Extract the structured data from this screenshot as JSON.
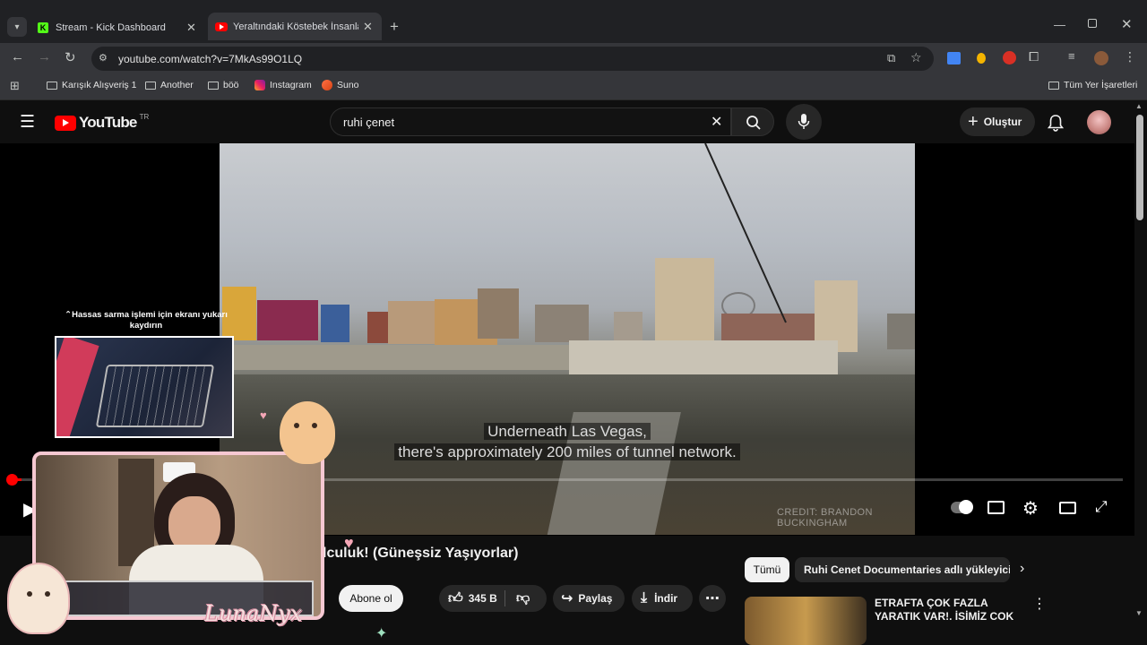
{
  "browser": {
    "tabs": [
      {
        "title": "Stream - Kick Dashboard",
        "active": false
      },
      {
        "title": "Yeraltındaki Köstebek İnsanlar'a",
        "active": true
      }
    ],
    "url": "youtube.com/watch?v=7MkAs99O1LQ",
    "bookmarks": [
      {
        "label": "Karışık Alışveriş 1",
        "icon": "folder-icon"
      },
      {
        "label": "Another",
        "icon": "folder-icon"
      },
      {
        "label": "böö",
        "icon": "folder-icon"
      },
      {
        "label": "Instagram",
        "icon": "instagram-icon"
      },
      {
        "label": "Suno",
        "icon": "suno-icon"
      }
    ],
    "all_bookmarks_label": "Tüm Yer İşaretleri"
  },
  "youtube": {
    "logo_text": "YouTube",
    "region": "TR",
    "search_value": "ruhi çenet",
    "create_label": "Oluştur"
  },
  "video": {
    "caption_line1": "Underneath Las Vegas,",
    "caption_line2": "there's approximately 200 miles of tunnel network.",
    "credit": "CREDIT: BRANDON BUCKINGHAM",
    "progress": 0.01
  },
  "below": {
    "title_fragment": "lculuk! (Güneşsiz Yaşıyorlar)",
    "subscribe_label": "Abone ol",
    "likes": "345 B",
    "share_label": "Paylaş",
    "download_label": "İndir"
  },
  "sidebar": {
    "chips": [
      {
        "label": "Tümü",
        "active": true
      },
      {
        "label": "Ruhi Cenet Documentaries adlı yükleyiciden",
        "active": false
      }
    ],
    "rec_title": "ETRAFTA ÇOK FAZLA YARATIK VAR!, İŞİMİZ ÇOK ZOR!..."
  },
  "overlay": {
    "scroll_hint": "Hassas sarma işlemi için ekranı yukarı kaydırın",
    "streamer_name": "LunaNyx"
  }
}
